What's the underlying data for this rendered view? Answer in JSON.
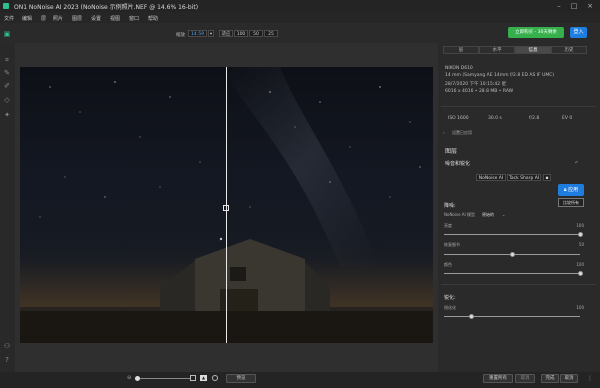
{
  "titlebar": {
    "title": "ON1 NoNoise AI 2023 (NoNoise 示例照片.NEF @ 14.6% 16-bit)"
  },
  "menu": [
    "文件",
    "编辑",
    "层",
    "照片",
    "图层",
    "设置",
    "视图",
    "窗口",
    "帮助"
  ],
  "toolbar": {
    "zoom_label": "缩放",
    "zoom_value": "14.59",
    "fit_label": "适应",
    "zoom_presets": [
      "100",
      "50",
      "25"
    ],
    "buy_label": "立即购买 - 30天剩余",
    "login_label": "登入"
  },
  "panel": {
    "tabs": [
      "层",
      "水平",
      "信息",
      "历史"
    ],
    "active_tab": "信息",
    "camera": "NIKON D610",
    "lens": "14 mm (Samyang AE 14mm f/2.8 ED AS IF UMC)",
    "date": "28/7/2020 下午 10:15:42 星",
    "size": "6016 x 4016 • 28.8 MB • RAW",
    "exif": {
      "iso": "ISO 1600",
      "shutter": "30.0 s",
      "aperture": "f/2.8",
      "ev": "EV 0"
    },
    "settings_toggle": "设置已应用",
    "layers_heading": "图层",
    "section_title": "噪音和锐化",
    "models": [
      "NoNoise AI",
      "Tack Sharp AI"
    ],
    "apply_label": "应用",
    "compare_label": "比较所有",
    "noise_heading": "降噪:",
    "noise_model_label": "NoNoise AI 模型",
    "noise_model_value": "原始的",
    "sliders": [
      {
        "name": "亮度",
        "value": "100",
        "level": 1.0
      },
      {
        "name": "恢复细节",
        "value": "50",
        "level": 0.5
      },
      {
        "name": "颜色",
        "value": "100",
        "level": 1.0
      }
    ],
    "sharpen_heading": "锐化:",
    "sharpen_slider": {
      "name": "锐化化",
      "value": "100",
      "level": 0.2
    }
  },
  "bottom": {
    "preview_label": "预览",
    "reset_label": "重置所有",
    "cancel_small": "取消",
    "done_label": "完成",
    "cancel_label": "取消"
  },
  "colors": {
    "accent_green": "#36b04c",
    "accent_blue": "#1f7de0"
  }
}
